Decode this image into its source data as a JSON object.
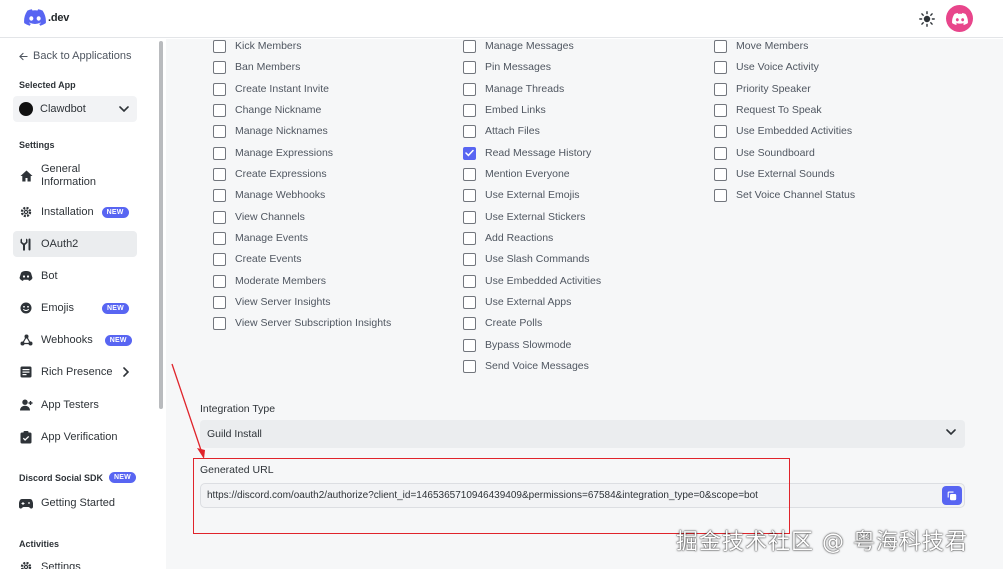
{
  "header": {
    "logo_text": ".dev"
  },
  "sidebar": {
    "back_label": "Back to Applications",
    "selected_app_label": "Selected App",
    "app_name": "Clawdbot",
    "settings_label": "Settings",
    "items": [
      {
        "label": "General Information",
        "icon": "home-icon",
        "badge": ""
      },
      {
        "label": "Installation",
        "icon": "gear-icon",
        "badge": "NEW"
      },
      {
        "label": "OAuth2",
        "icon": "wrench-icon",
        "badge": ""
      },
      {
        "label": "Bot",
        "icon": "bot-icon",
        "badge": ""
      },
      {
        "label": "Emojis",
        "icon": "smiley-icon",
        "badge": "NEW"
      },
      {
        "label": "Webhooks",
        "icon": "webhook-icon",
        "badge": "NEW"
      },
      {
        "label": "Rich Presence",
        "icon": "card-icon",
        "badge": ""
      },
      {
        "label": "App Testers",
        "icon": "user-plus-icon",
        "badge": ""
      },
      {
        "label": "App Verification",
        "icon": "verified-icon",
        "badge": ""
      }
    ],
    "social_sdk_label": "Discord Social SDK",
    "social_sdk_badge": "NEW",
    "getting_started": "Getting Started",
    "activities_label": "Activities",
    "activities_settings": "Settings"
  },
  "permissions": {
    "col1": [
      {
        "label": "Kick Members",
        "checked": false
      },
      {
        "label": "Ban Members",
        "checked": false
      },
      {
        "label": "Create Instant Invite",
        "checked": false
      },
      {
        "label": "Change Nickname",
        "checked": false
      },
      {
        "label": "Manage Nicknames",
        "checked": false
      },
      {
        "label": "Manage Expressions",
        "checked": false
      },
      {
        "label": "Create Expressions",
        "checked": false
      },
      {
        "label": "Manage Webhooks",
        "checked": false
      },
      {
        "label": "View Channels",
        "checked": false
      },
      {
        "label": "Manage Events",
        "checked": false
      },
      {
        "label": "Create Events",
        "checked": false
      },
      {
        "label": "Moderate Members",
        "checked": false
      },
      {
        "label": "View Server Insights",
        "checked": false
      },
      {
        "label": "View Server Subscription Insights",
        "checked": false
      }
    ],
    "col2": [
      {
        "label": "Manage Messages",
        "checked": false
      },
      {
        "label": "Pin Messages",
        "checked": false
      },
      {
        "label": "Manage Threads",
        "checked": false
      },
      {
        "label": "Embed Links",
        "checked": false
      },
      {
        "label": "Attach Files",
        "checked": false
      },
      {
        "label": "Read Message History",
        "checked": true
      },
      {
        "label": "Mention Everyone",
        "checked": false
      },
      {
        "label": "Use External Emojis",
        "checked": false
      },
      {
        "label": "Use External Stickers",
        "checked": false
      },
      {
        "label": "Add Reactions",
        "checked": false
      },
      {
        "label": "Use Slash Commands",
        "checked": false
      },
      {
        "label": "Use Embedded Activities",
        "checked": false
      },
      {
        "label": "Use External Apps",
        "checked": false
      },
      {
        "label": "Create Polls",
        "checked": false
      },
      {
        "label": "Bypass Slowmode",
        "checked": false
      },
      {
        "label": "Send Voice Messages",
        "checked": false
      }
    ],
    "col3": [
      {
        "label": "Move Members",
        "checked": false
      },
      {
        "label": "Use Voice Activity",
        "checked": false
      },
      {
        "label": "Priority Speaker",
        "checked": false
      },
      {
        "label": "Request To Speak",
        "checked": false
      },
      {
        "label": "Use Embedded Activities",
        "checked": false
      },
      {
        "label": "Use Soundboard",
        "checked": false
      },
      {
        "label": "Use External Sounds",
        "checked": false
      },
      {
        "label": "Set Voice Channel Status",
        "checked": false
      }
    ]
  },
  "integration": {
    "label": "Integration Type",
    "value": "Guild Install"
  },
  "generated_url": {
    "label": "Generated URL",
    "value": "https://discord.com/oauth2/authorize?client_id=1465365710946439409&permissions=67584&integration_type=0&scope=bot"
  },
  "watermark": "掘金技术社区 @ 粤海科技君",
  "colors": {
    "accent": "#5865f2",
    "avatar": "#e8458b",
    "annotation": "#e0242b"
  }
}
